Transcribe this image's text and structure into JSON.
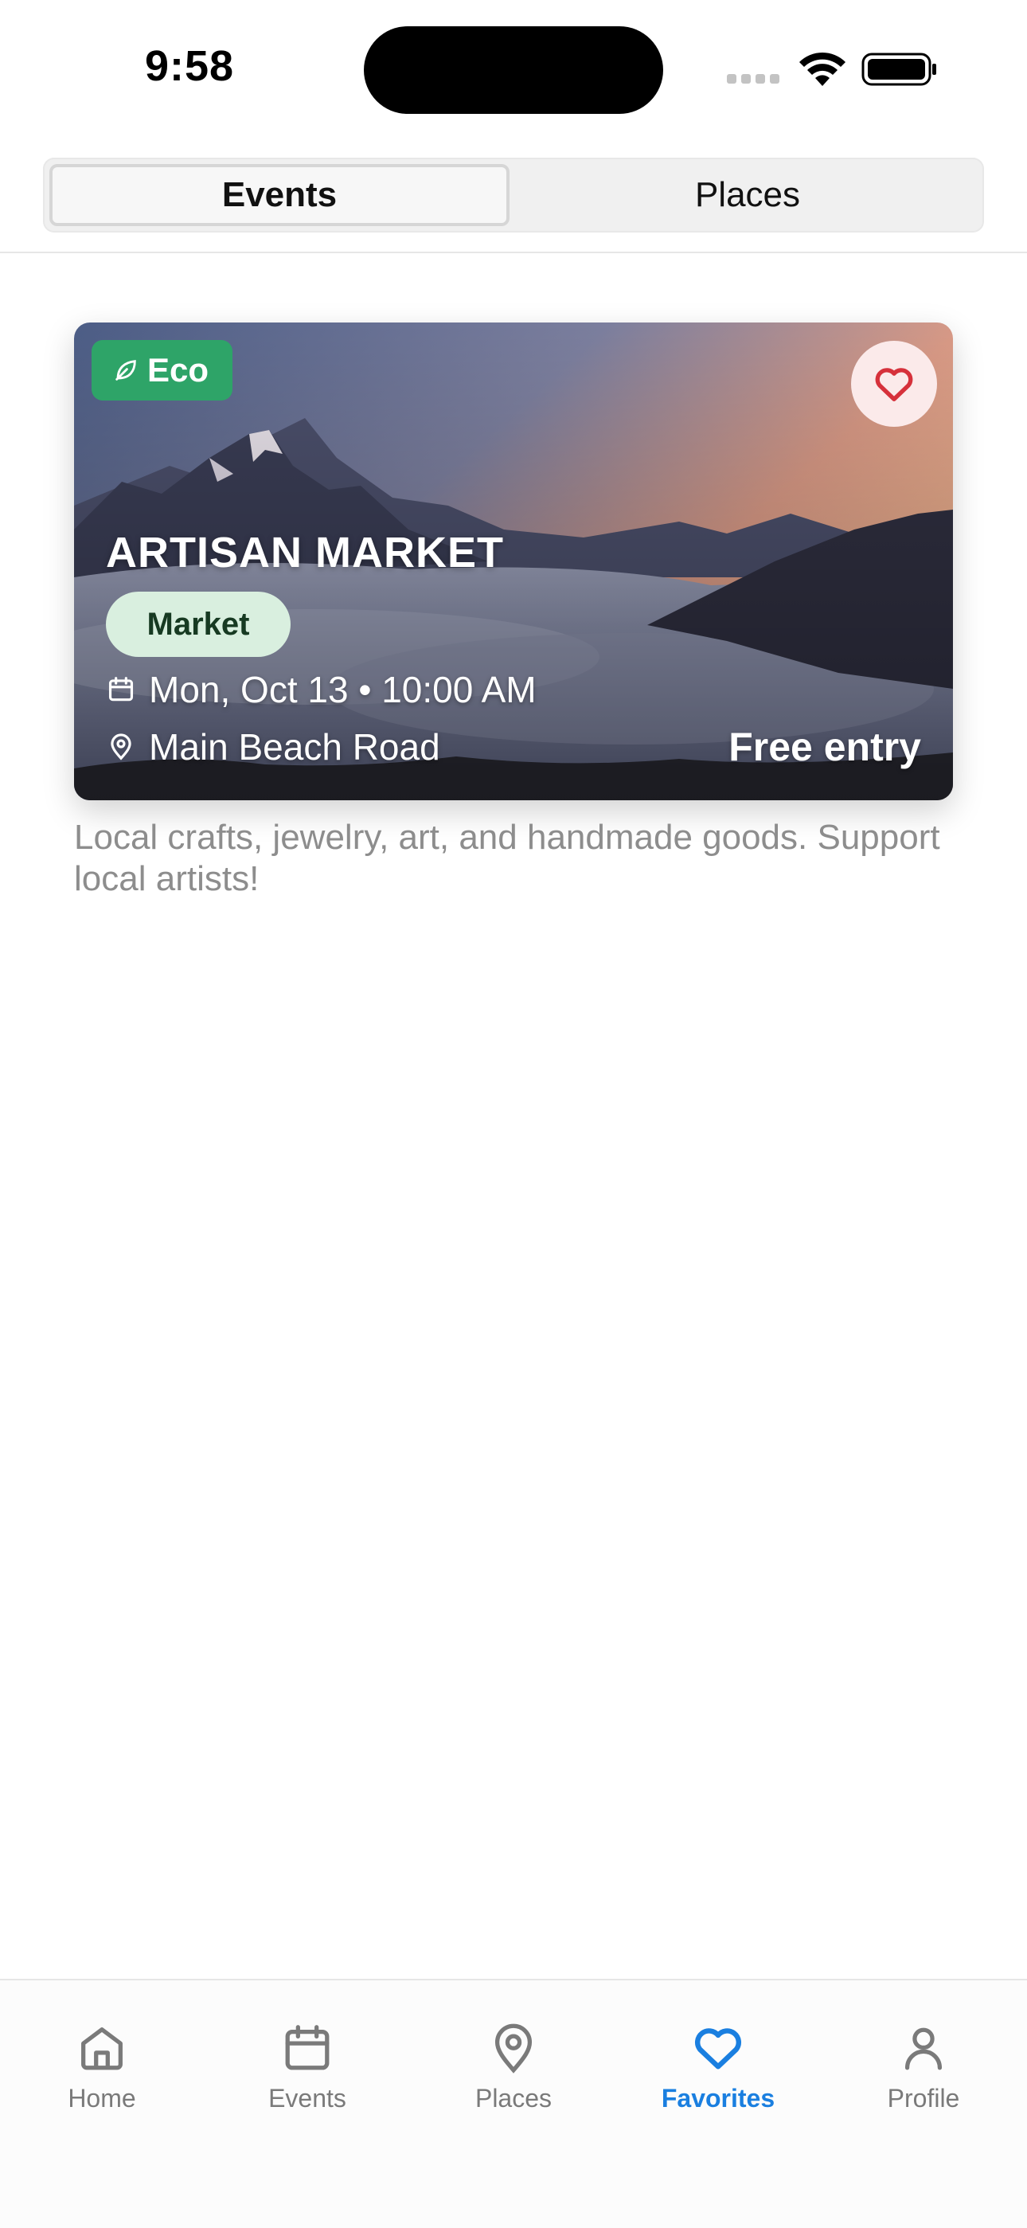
{
  "status_bar": {
    "time": "9:58"
  },
  "segmented": {
    "tabs": [
      "Events",
      "Places"
    ],
    "selected": "Events"
  },
  "event_card": {
    "eco_label": "Eco",
    "title": "ARTISAN MARKET",
    "category": "Market",
    "date_time": "Mon, Oct 13 • 10:00 AM",
    "location": "Main Beach Road",
    "price": "Free entry",
    "favorited": true,
    "description": "Local crafts, jewelry, art, and handmade goods. Support local artists!"
  },
  "tab_bar": {
    "items": [
      {
        "label": "Home",
        "icon": "home-icon"
      },
      {
        "label": "Events",
        "icon": "calendar-icon"
      },
      {
        "label": "Places",
        "icon": "map-pin-icon"
      },
      {
        "label": "Favorites",
        "icon": "heart-icon"
      },
      {
        "label": "Profile",
        "icon": "person-icon"
      }
    ],
    "active": "Favorites"
  },
  "colors": {
    "accent_blue": "#1a7fe0",
    "eco_green": "#2ea468",
    "category_pill": "#d9efdf",
    "heart_red": "#d6313b"
  }
}
